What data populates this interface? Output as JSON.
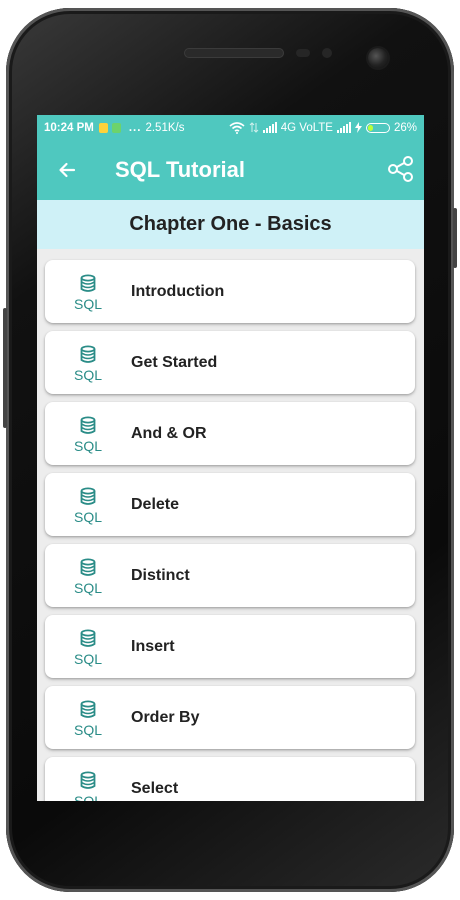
{
  "status_bar": {
    "time": "10:24 PM",
    "dots": "...",
    "speed": "2.51K/s",
    "network": "4G VoLTE",
    "battery": "26%",
    "battery_level": 0.26
  },
  "app_bar": {
    "title": "SQL Tutorial",
    "back_icon": "arrow-back-icon",
    "share_icon": "share-icon"
  },
  "chapter": {
    "title": "Chapter One - Basics"
  },
  "list_icon_text": "SQL",
  "list": [
    {
      "label": "Introduction"
    },
    {
      "label": "Get Started"
    },
    {
      "label": "And & OR"
    },
    {
      "label": "Delete"
    },
    {
      "label": "Distinct"
    },
    {
      "label": "Insert"
    },
    {
      "label": "Order By"
    },
    {
      "label": "Select"
    }
  ],
  "colors": {
    "primary": "#4fc8bf",
    "chapter_bg": "#cff1f7",
    "icon": "#2a8c87"
  }
}
